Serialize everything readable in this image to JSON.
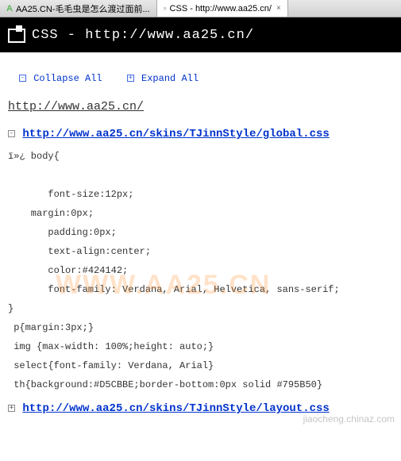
{
  "tabs": [
    {
      "icon": "A",
      "label": "AA25.CN-毛毛虫是怎么渡过面前..."
    },
    {
      "icon": "📄",
      "label": "CSS - http://www.aa25.cn/"
    }
  ],
  "header": {
    "title": "CSS - http://www.aa25.cn/"
  },
  "controls": {
    "collapse": {
      "icon": "-",
      "label": "Collapse All"
    },
    "expand": {
      "icon": "+",
      "label": "Expand All"
    }
  },
  "page_url": "http://www.aa25.cn/",
  "sections": [
    {
      "icon": "-",
      "url": "http://www.aa25.cn/skins/TJinnStyle/global.css",
      "code": "ï»¿ body{\n\n       font-size:12px;\n    margin:0px;\n       padding:0px;\n       text-align:center;\n       color:#424142;\n       font-family: Verdana, Arial, Helvetica, sans-serif;\n}\n p{margin:3px;}\n img {max-width: 100%;height: auto;}\n select{font-family: Verdana, Arial}\n th{background:#D5CBBE;border-bottom:0px solid #795B50}"
    },
    {
      "icon": "+",
      "url": "http://www.aa25.cn/skins/TJinnStyle/layout.css",
      "code": ""
    }
  ],
  "watermark": "WWW.AA25.CN",
  "footer_watermark": "jiaocheng.chinaz.com"
}
